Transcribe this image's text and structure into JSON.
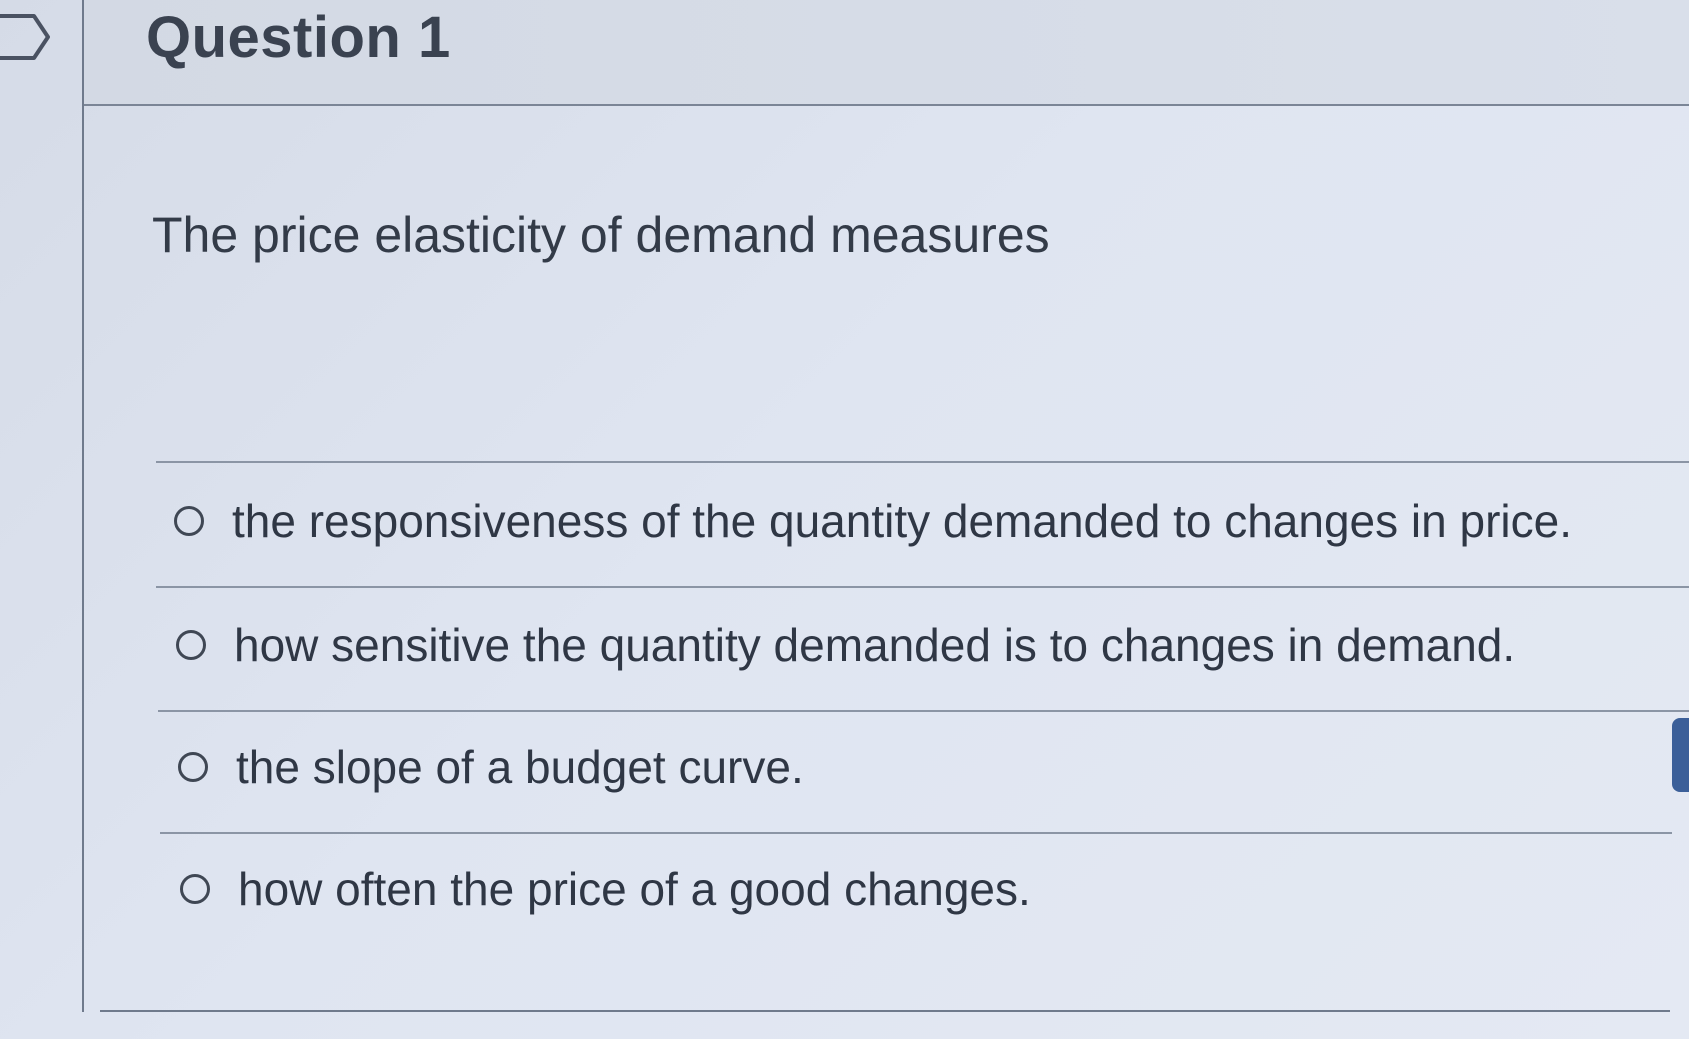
{
  "header": {
    "title": "Question 1"
  },
  "question": {
    "prompt": "The price elasticity of demand measures",
    "options": [
      {
        "label": "the responsiveness of the quantity demanded to changes in price."
      },
      {
        "label": "how sensitive the quantity demanded is to changes in demand."
      },
      {
        "label": "the slope of a budget curve."
      },
      {
        "label": "how often the price of a good changes."
      }
    ]
  },
  "icons": {
    "flag": "flag-outline-icon",
    "radio": "radio-unselected-icon"
  },
  "colors": {
    "background": "#dfe5f1",
    "text": "#2f3745",
    "accent_tab": "#3b5f99"
  }
}
